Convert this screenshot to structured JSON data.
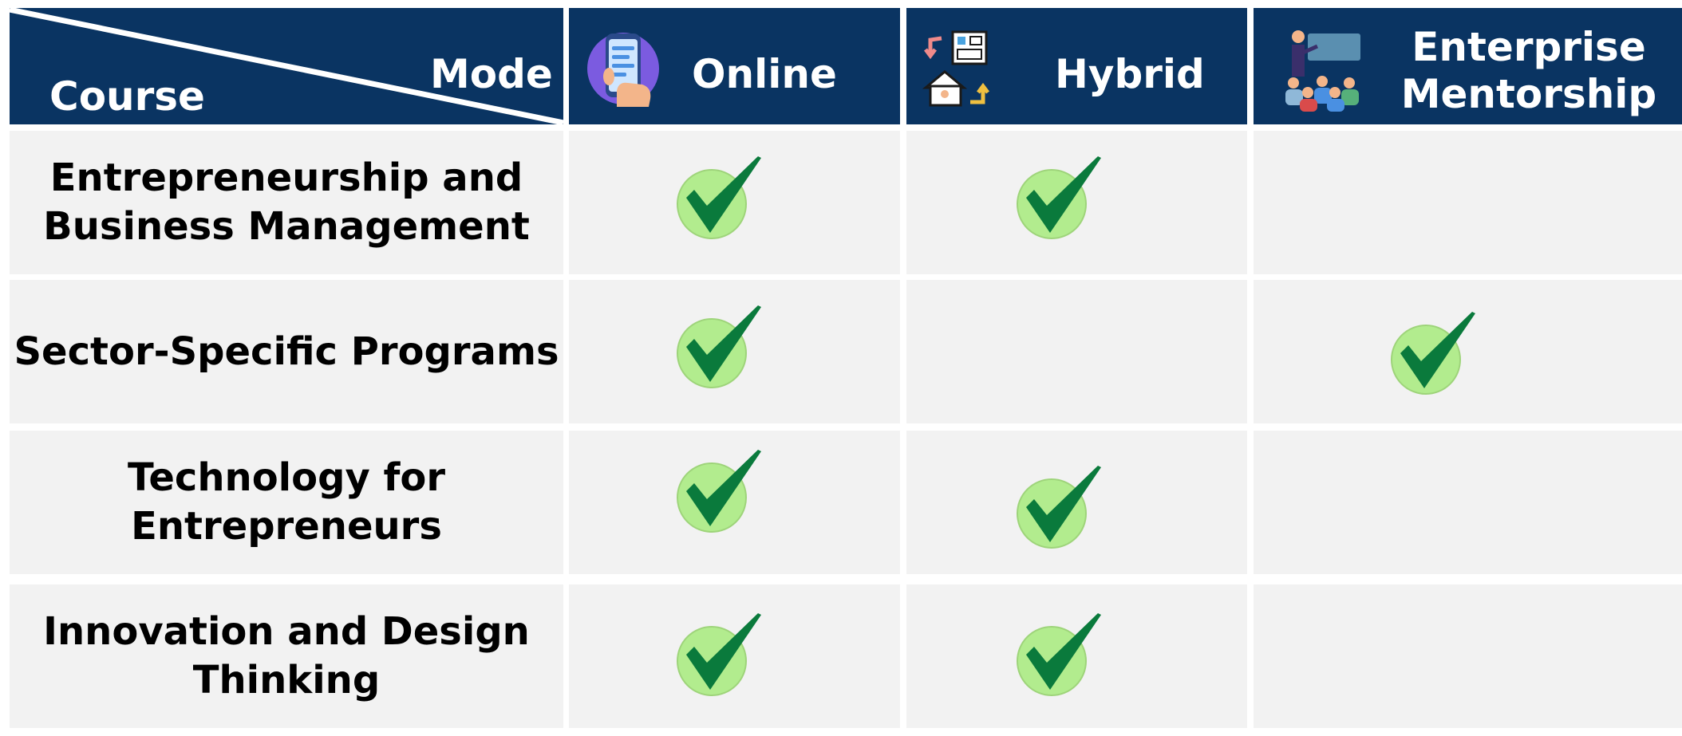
{
  "header": {
    "corner_course_label": "Course",
    "corner_mode_label": "Mode",
    "modes": [
      {
        "id": "online",
        "label": "Online",
        "icon": "smartphone-app-icon"
      },
      {
        "id": "hybrid",
        "label": "Hybrid",
        "icon": "office-home-switch-icon"
      },
      {
        "id": "enterprise",
        "label": "Enterprise\nMentorship",
        "icon": "mentor-presentation-icon"
      }
    ]
  },
  "rows": [
    {
      "course": "Entrepreneurship and\nBusiness Management",
      "online": true,
      "hybrid": true,
      "enterprise": false
    },
    {
      "course": "Sector-Specific Programs",
      "online": true,
      "hybrid": false,
      "enterprise": true
    },
    {
      "course": "Technology for\nEntrepreneurs",
      "online": true,
      "hybrid": true,
      "enterprise": false
    },
    {
      "course": "Innovation and Design\nThinking",
      "online": true,
      "hybrid": true,
      "enterprise": false
    }
  ],
  "colors": {
    "header_bg": "#0a3462",
    "cell_bg": "#f2f2f2",
    "check_circle": "#b2ec8e",
    "check_mark": "#0a7a3c"
  }
}
